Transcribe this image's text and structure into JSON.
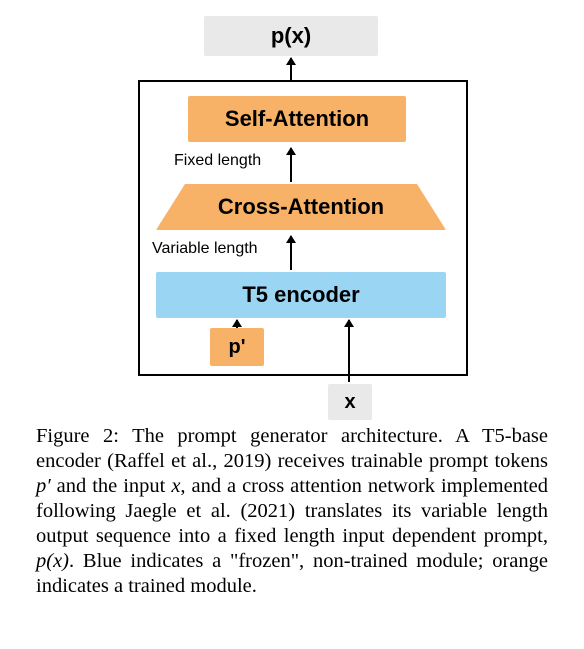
{
  "diagram": {
    "output_block": "p(x)",
    "self_attention": "Self-Attention",
    "cross_attention": "Cross-Attention",
    "t5_encoder": "T5 encoder",
    "p_prime": "p'",
    "x_input": "x",
    "fixed_length_label": "Fixed length",
    "variable_length_label": "Variable length"
  },
  "caption": {
    "prefix": "Figure 2: ",
    "body_1": "The prompt generator architecture. A T5-base encoder (Raffel et al., 2019) receives trainable prompt tokens ",
    "p_prime": "p′",
    "body_2": " and the input ",
    "x": "x",
    "body_3": ", and a cross attention network implemented following Jaegle et al. (2021) translates its variable length output sequence into a fixed length input dependent prompt, ",
    "px": "p(x)",
    "body_4": ". Blue indicates a \"frozen\", non-trained module; orange indicates a trained module."
  }
}
